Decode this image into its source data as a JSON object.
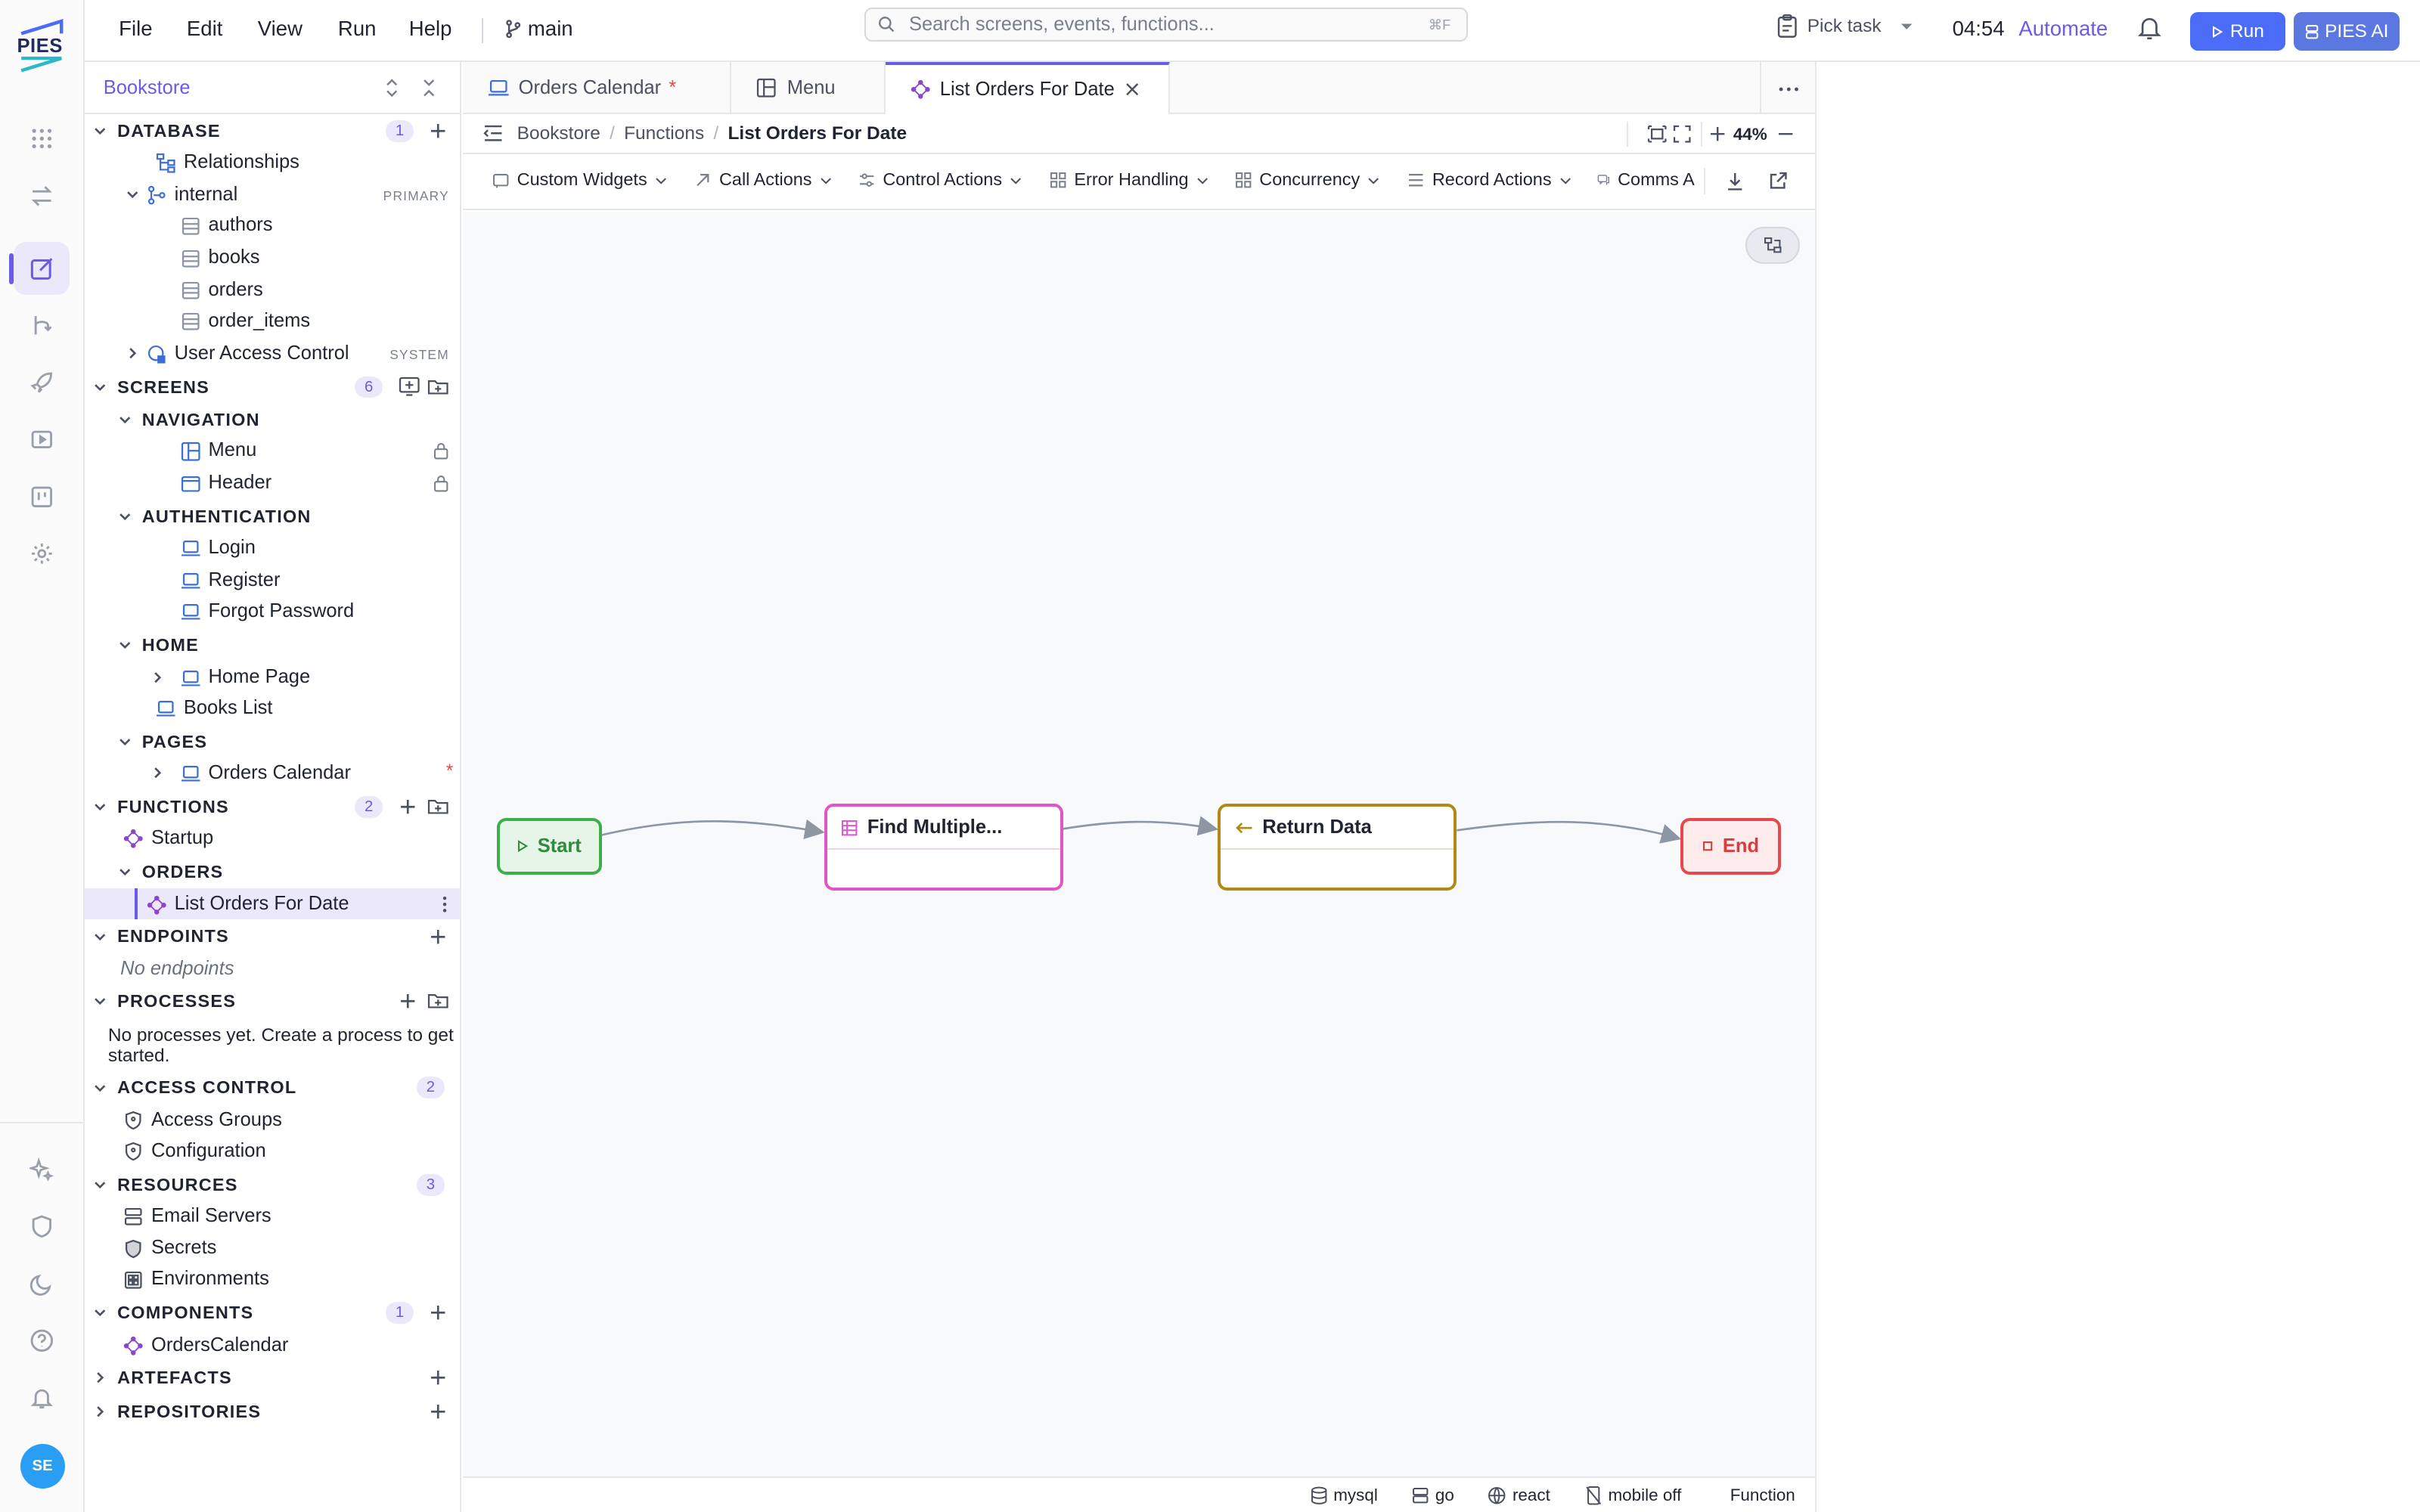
{
  "app": {
    "logo": "PIES"
  },
  "menu": {
    "file": "File",
    "edit": "Edit",
    "view": "View",
    "run": "Run",
    "help": "Help",
    "branch": "main"
  },
  "search": {
    "placeholder": "Search screens, events, functions...",
    "shortcut": "⌘F"
  },
  "header": {
    "pick_task": "Pick task",
    "time": "04:54",
    "automate": "Automate",
    "run": "Run",
    "ai": "PIES AI"
  },
  "rail": {
    "avatar": "SE",
    "icons": [
      "grid-icon",
      "swap-icon",
      "edit-icon",
      "branch-icon",
      "rocket-icon",
      "play-icon",
      "board-icon",
      "gear-icon",
      "sparkle-icon",
      "shield-icon",
      "moon-icon",
      "help-icon",
      "bell-icon"
    ]
  },
  "sidebar": {
    "project": "Bookstore",
    "database": {
      "title": "DATABASE",
      "count": "1",
      "relationships": "Relationships",
      "schema": "internal",
      "schema_tag": "PRIMARY",
      "tables": [
        "authors",
        "books",
        "orders",
        "order_items"
      ],
      "uac": "User Access Control",
      "uac_tag": "SYSTEM"
    },
    "screens": {
      "title": "SCREENS",
      "count": "6",
      "navigation": "NAVIGATION",
      "menu": "Menu",
      "header": "Header",
      "authentication": "AUTHENTICATION",
      "login": "Login",
      "register": "Register",
      "forgot": "Forgot Password",
      "home": "HOME",
      "home_page": "Home Page",
      "books_list": "Books List",
      "pages": "PAGES",
      "orders_calendar": "Orders Calendar",
      "modified": "*"
    },
    "functions": {
      "title": "FUNCTIONS",
      "count": "2",
      "startup": "Startup",
      "orders": "ORDERS",
      "list_orders": "List Orders For Date"
    },
    "endpoints": {
      "title": "ENDPOINTS",
      "empty": "No endpoints"
    },
    "processes": {
      "title": "PROCESSES",
      "empty": "No processes yet. Create a process to get started."
    },
    "access_control": {
      "title": "ACCESS CONTROL",
      "count": "2",
      "groups": "Access Groups",
      "config": "Configuration"
    },
    "resources": {
      "title": "RESOURCES",
      "count": "3",
      "email": "Email Servers",
      "secrets": "Secrets",
      "envs": "Environments"
    },
    "components": {
      "title": "COMPONENTS",
      "count": "1",
      "orders_calendar": "OrdersCalendar"
    },
    "artefacts": {
      "title": "ARTEFACTS"
    },
    "repositories": {
      "title": "REPOSITORIES"
    }
  },
  "tabs": [
    {
      "label": "Orders Calendar",
      "modified": "*"
    },
    {
      "label": "Menu"
    },
    {
      "label": "List Orders For Date"
    }
  ],
  "breadcrumb": {
    "root": "Bookstore",
    "section": "Functions",
    "current": "List Orders For Date",
    "zoom": "44%"
  },
  "toolbar": [
    "Custom Widgets",
    "Call Actions",
    "Control Actions",
    "Error Handling",
    "Concurrency",
    "Record Actions",
    "Comms A"
  ],
  "flow": {
    "start": "Start",
    "find": "Find Multiple...",
    "return": "Return Data",
    "end": "End"
  },
  "status": {
    "db": "mysql",
    "backend": "go",
    "frontend": "react",
    "mobile": "mobile off",
    "type": "Function"
  },
  "colors": {
    "accent": "#6b5be6",
    "run_button": "#4a6cf7",
    "ai_button": "#5b78e0",
    "start": "#3fae4a",
    "find": "#e255c9",
    "return": "#b08a16",
    "end": "#e5484d"
  }
}
